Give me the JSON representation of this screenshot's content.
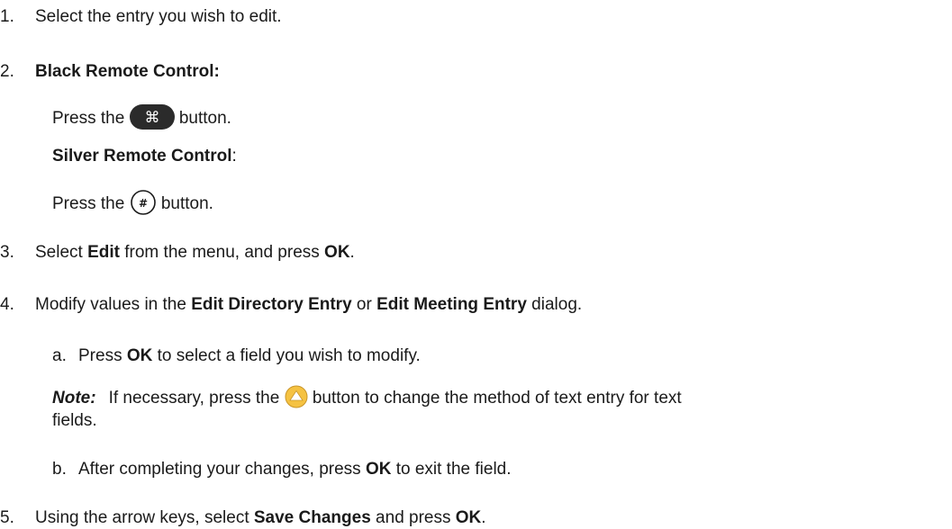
{
  "steps": [
    {
      "num": "1.",
      "text": "Select the entry you wish to edit."
    },
    {
      "num": "2.",
      "heading": "Black Remote Control:"
    },
    {
      "num": "3.",
      "pre": "Select ",
      "b1": "Edit",
      "mid": " from the menu, and press ",
      "b2": "OK",
      "post": "."
    },
    {
      "num": "4.",
      "pre": "Modify values in the ",
      "b1": "Edit Directory Entry",
      "mid": " or ",
      "b2": "Edit Meeting Entry",
      "post": " dialog."
    },
    {
      "num": "5.",
      "pre": "Using the arrow keys, select ",
      "b1": "Save Changes",
      "mid": " and press ",
      "b2": "OK",
      "post": "."
    }
  ],
  "black_remote": {
    "press_pre": "Press the ",
    "press_post": " button.",
    "icon": "command-key-icon",
    "glyph": "⌘"
  },
  "silver_remote": {
    "heading": "Silver Remote Control",
    "heading_suffix": ":",
    "press_pre": "Press the ",
    "press_post": " button.",
    "icon": "hash-key-icon",
    "glyph": "#"
  },
  "substeps": [
    {
      "label": "a.",
      "pre": "Press ",
      "b": "OK",
      "post": " to select a field you wish to modify."
    },
    {
      "label": "b.",
      "pre": "After completing your changes, press ",
      "b": "OK",
      "post": " to exit the field."
    }
  ],
  "note": {
    "label": "Note:",
    "pre": "If necessary, press the ",
    "post_line1": " button to change the method of text entry for text",
    "line2": "fields.",
    "icon": "yellow-up-arrow-icon",
    "icon_color": "#f5c242"
  }
}
